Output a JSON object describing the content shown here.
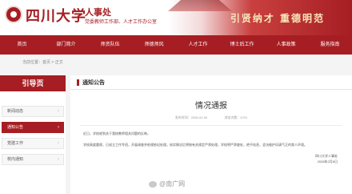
{
  "header": {
    "school_name": "四川大学",
    "dept_name": "人事处",
    "dept_sub": "党委教师工作部、人才工作办公室",
    "motto": "引贤纳才 重德明范"
  },
  "nav": [
    "首页",
    "部门简介",
    "师资队伍",
    "师德师风",
    "人才工作",
    "博士后工作",
    "人事政策",
    "服务指南"
  ],
  "breadcrumb": "当前位置：首页 > 正文",
  "sidebar": {
    "title": "引导页",
    "items": [
      {
        "label": "新闻动态"
      },
      {
        "label": "通知公告"
      },
      {
        "label": "党建工作"
      },
      {
        "label": "校内通知"
      }
    ]
  },
  "main": {
    "section_title": "通知公告",
    "article_title": "情况通报",
    "meta_date": "发布时间：2026-02-00",
    "meta_views": "浏览次数：4791",
    "paragraph1": "近日，学校收到关于我校教师相关问题的反映。",
    "paragraph2": "学校高度重视，已成立工作专班，开展调查并依规依纪处理。核实情况后将按有关规定严肃处理，学校将严肃查处，绝不姑息，坚决维护风清气正的育人环境。",
    "sign_org": "四川大学人事处",
    "sign_date": "2026年2月6日"
  },
  "watermark": "@南广网",
  "colors": {
    "brand": "#a61e23"
  }
}
